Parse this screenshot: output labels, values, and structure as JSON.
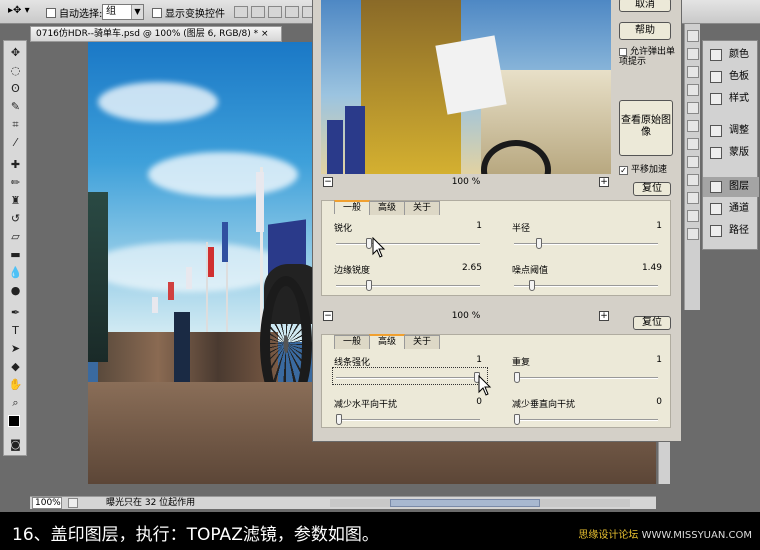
{
  "options_bar": {
    "auto_select_label": "自动选择:",
    "auto_select_value": "组",
    "show_transform_label": "显示变换控件"
  },
  "document": {
    "tab_title": "0716仿HDR--骑单车.psd @ 100% (图层 6, RGB/8) *",
    "close_glyph": "×"
  },
  "status_bar": {
    "zoom": "100%",
    "info": "曝光只在 32 位起作用"
  },
  "panels": [
    {
      "label": "颜色",
      "icon": "color-icon"
    },
    {
      "label": "色板",
      "icon": "swatches-icon"
    },
    {
      "label": "样式",
      "icon": "styles-icon"
    },
    {
      "label": "调整",
      "icon": "adjustments-icon"
    },
    {
      "label": "蒙版",
      "icon": "masks-icon"
    },
    {
      "label": "图层",
      "icon": "layers-icon"
    },
    {
      "label": "通道",
      "icon": "channels-icon"
    },
    {
      "label": "路径",
      "icon": "paths-icon"
    }
  ],
  "dialog": {
    "cancel_label": "取消",
    "help_label": "帮助",
    "allow_popup_label": "允许弹出单项提示",
    "view_original_label": "查看原始图像",
    "pan_accel_label": "平移加速",
    "pan_accel_checked": true,
    "preview_zoom": "100 %",
    "zoom_minus": "−",
    "zoom_plus": "+",
    "reset_label": "复位",
    "sharpen_section": {
      "tabs": [
        "一般",
        "高级",
        "关于"
      ],
      "active_tab": "一般",
      "sharpen_label": "锐化",
      "sharpen_value": "1",
      "sharpen_fraction": 0.22,
      "radius_label": "半径",
      "radius_value": "1",
      "radius_fraction": 0.16,
      "edge_label": "边缘锐度",
      "edge_value": "2.65",
      "edge_fraction": 0.22,
      "noise_label": "噪点阈值",
      "noise_value": "1.49",
      "noise_fraction": 0.11
    },
    "advanced_section": {
      "tabs": [
        "一般",
        "高级",
        "关于"
      ],
      "active_tab": "高级",
      "line_label": "线条强化",
      "line_value": "1",
      "line_fraction": 1.0,
      "repeat_label": "重复",
      "repeat_value": "1",
      "repeat_fraction": 0.0,
      "h_noise_label": "减少水平向干扰",
      "h_noise_value": "0",
      "h_noise_fraction": 0.0,
      "v_noise_label": "减少垂直向干扰",
      "v_noise_value": "0",
      "v_noise_fraction": 0.0
    }
  },
  "caption": {
    "text": "16、盖印图层，执行：TOPAZ滤镜，参数如图。",
    "watermark_a": "思缘设计论坛",
    "watermark_b": "WWW.MISSYUAN.COM"
  }
}
